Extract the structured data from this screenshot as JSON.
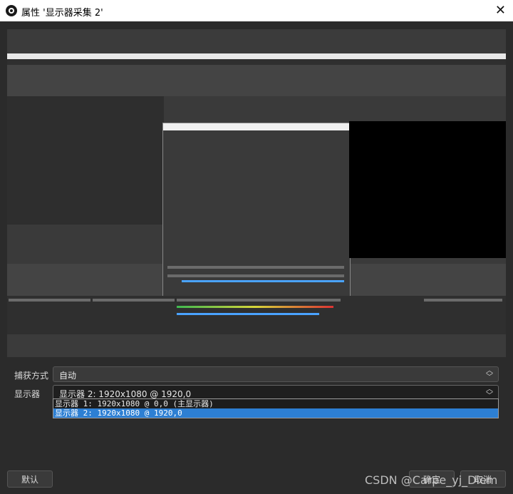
{
  "window": {
    "title": "属性 '显示器采集 2'",
    "close_glyph": "✕"
  },
  "form": {
    "capture_method": {
      "label": "捕获方式",
      "value": "自动"
    },
    "display": {
      "label": "显示器",
      "value": "显示器 2: 1920x1080 @ 1920,0",
      "options": [
        "显示器 1: 1920x1080 @ 0,0 (主显示器)",
        "显示器 2: 1920x1080 @ 1920,0"
      ],
      "selected_index": 1
    }
  },
  "buttons": {
    "defaults": "默认",
    "ok": "确定",
    "cancel": "取消"
  },
  "watermark": "CSDN @Carpe_yj_Diem",
  "colors": {
    "accent": "#2d7fd3",
    "bg": "#2b2b2b"
  }
}
